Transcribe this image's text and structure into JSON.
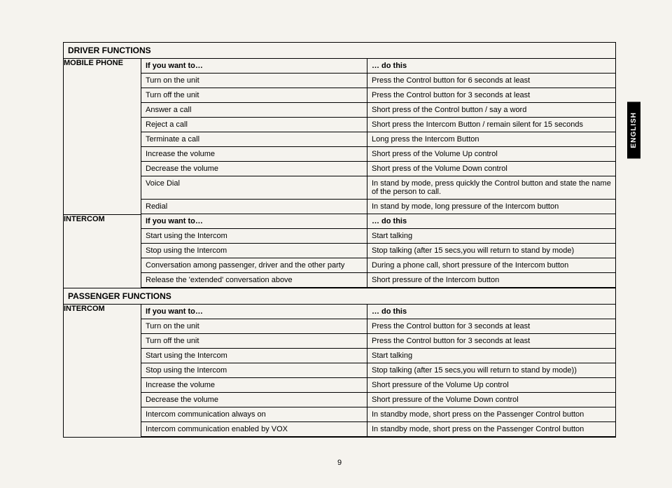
{
  "side_tab": "ENGLISH",
  "page_number": "9",
  "driver_title": "DRIVER FUNCTIONS",
  "passenger_title": "PASSENGER FUNCTIONS",
  "labels": {
    "mobile_phone": "MOBILE PHONE",
    "intercom": "INTERCOM",
    "if_you_want": "If you want to…",
    "do_this": "… do this"
  },
  "mobile_phone_rows": [
    {
      "a": "Turn on the unit",
      "b": "Press the Control button for 6 seconds at least"
    },
    {
      "a": "Turn off the unit",
      "b": "Press the Control button for 3 seconds at least"
    },
    {
      "a": "Answer a call",
      "b": "Short press of the Control button / say a word"
    },
    {
      "a": "Reject a call",
      "b": "Short press the Intercom Button / remain silent for 15 seconds"
    },
    {
      "a": "Terminate a call",
      "b": "Long press the Intercom Button"
    },
    {
      "a": "Increase the volume",
      "b": "Short press of the Volume Up control"
    },
    {
      "a": "Decrease the volume",
      "b": "Short press of the Volume Down control"
    },
    {
      "a": "Voice Dial",
      "b": "In stand by mode, press quickly the Control button and state the name of the person to call."
    },
    {
      "a": "Redial",
      "b": "In stand by mode, long pressure of the Intercom button"
    }
  ],
  "driver_intercom_rows": [
    {
      "a": "Start using the Intercom",
      "b": "Start talking"
    },
    {
      "a": "Stop using the Intercom",
      "b": "Stop talking (after 15 secs,you will return to stand by mode)"
    },
    {
      "a": "Conversation among passenger, driver and the other party",
      "b": "During a phone call, short pressure of the Intercom button"
    },
    {
      "a": "Release the 'extended' conversation above",
      "b": "Short pressure of the Intercom button"
    }
  ],
  "passenger_intercom_rows": [
    {
      "a": "Turn on the unit",
      "b": "Press the Control button for 3 seconds at least"
    },
    {
      "a": "Turn off the unit",
      "b": "Press the Control button for 3 seconds at least"
    },
    {
      "a": "Start using the Intercom",
      "b": "Start talking"
    },
    {
      "a": "Stop using the Intercom",
      "b": "Stop talking (after 15 secs,you will return to stand by mode))"
    },
    {
      "a": "Increase the volume",
      "b": "Short pressure of the Volume Up control"
    },
    {
      "a": "Decrease the volume",
      "b": "Short pressure of the Volume Down control"
    },
    {
      "a": "Intercom communication always on",
      "b": "In standby mode, short press on the Passenger Control button"
    },
    {
      "a": "Intercom communication enabled by VOX",
      "b": "In standby mode, short press on the Passenger Control button"
    }
  ]
}
